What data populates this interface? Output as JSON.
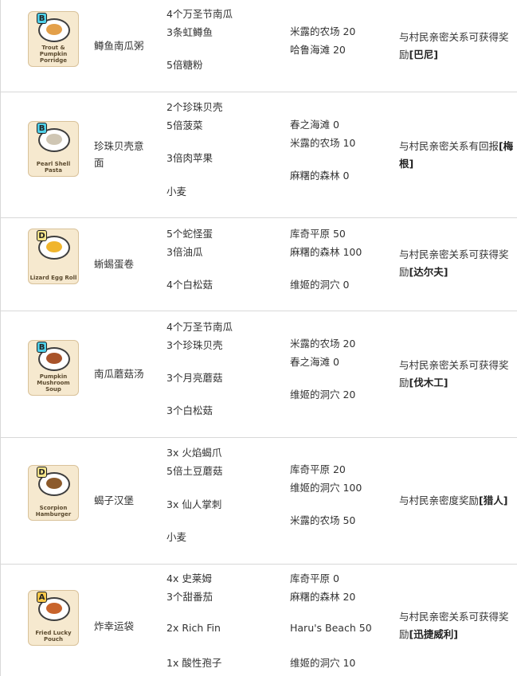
{
  "recipes": [
    {
      "card_title": "Trout & Pumpkin Porridge",
      "grade": "B",
      "grade_color": "#4fd0e8",
      "food_color": "#e3a04a",
      "name": "鳟鱼南瓜粥",
      "ingredients": [
        "4个万圣节南瓜",
        "3条虹鳟鱼",
        "5倍糖粉"
      ],
      "sources": [
        "米露的农场 20",
        "哈鲁海滩 20"
      ],
      "unlock_text": "与村民亲密关系可获得奖励",
      "unlock_person": "[巴尼]"
    },
    {
      "card_title": "Pearl Shell Pasta",
      "grade": "B",
      "grade_color": "#4fd0e8",
      "food_color": "#cfc6b4",
      "name": "珍珠贝壳意面",
      "ingredients": [
        "2个珍珠贝壳",
        "5倍菠菜",
        "3倍肉苹果",
        "小麦"
      ],
      "sources": [
        "春之海滩 0",
        "米露的农场 10",
        "麻糬的森林 0"
      ],
      "unlock_text": "与村民亲密关系有回报",
      "unlock_person": "[梅根]"
    },
    {
      "card_title": "Lizard Egg Roll",
      "grade": "D",
      "grade_color": "#f3e48a",
      "food_color": "#f0b52d",
      "name": "蜥蜴蛋卷",
      "ingredients": [
        "5个蛇怪蛋",
        "3倍油瓜",
        "4个白松菇"
      ],
      "sources": [
        "库奇平原 50",
        "麻糬的森林 100",
        "维姬的洞穴 0"
      ],
      "unlock_text": "与村民亲密关系可获得奖励",
      "unlock_person": "[达尔夫]"
    },
    {
      "card_title": "Pumpkin Mushroom Soup",
      "grade": "B",
      "grade_color": "#4fd0e8",
      "food_color": "#a8532a",
      "name": "南瓜蘑菇汤",
      "ingredients": [
        "4个万圣节南瓜",
        "3个珍珠贝壳",
        "3个月亮蘑菇",
        "3个白松菇"
      ],
      "sources": [
        "米露的农场 20",
        "春之海滩 0",
        "维姬的洞穴 20"
      ],
      "unlock_text": "与村民亲密关系可获得奖励",
      "unlock_person": "[伐木工]"
    },
    {
      "card_title": "Scorpion Hamburger",
      "grade": "D",
      "grade_color": "#f3e48a",
      "food_color": "#8c5a2b",
      "name": "蝎子汉堡",
      "ingredients": [
        "3x 火焰蝎爪",
        "5倍土豆蘑菇",
        "3x 仙人掌刺",
        "小麦"
      ],
      "sources": [
        "库奇平原 20",
        "维姬的洞穴 100",
        "米露的农场 50"
      ],
      "unlock_text": "与村民亲密度奖励",
      "unlock_person": "[猎人]"
    },
    {
      "card_title": "Fried Lucky Pouch",
      "grade": "A",
      "grade_color": "#f7c84a",
      "food_color": "#c8642c",
      "name": "炸幸运袋",
      "ingredients": [
        "4x 史莱姆",
        "3个甜番茄",
        "2x Rich Fin",
        "1x 酸性孢子"
      ],
      "sources": [
        "库奇平原 0",
        "麻糬的森林 20",
        "Haru's Beach 50",
        "维姬的洞穴 10"
      ],
      "unlock_text": "与村民亲密关系可获得奖励",
      "unlock_person": "[迅捷威利]"
    }
  ]
}
